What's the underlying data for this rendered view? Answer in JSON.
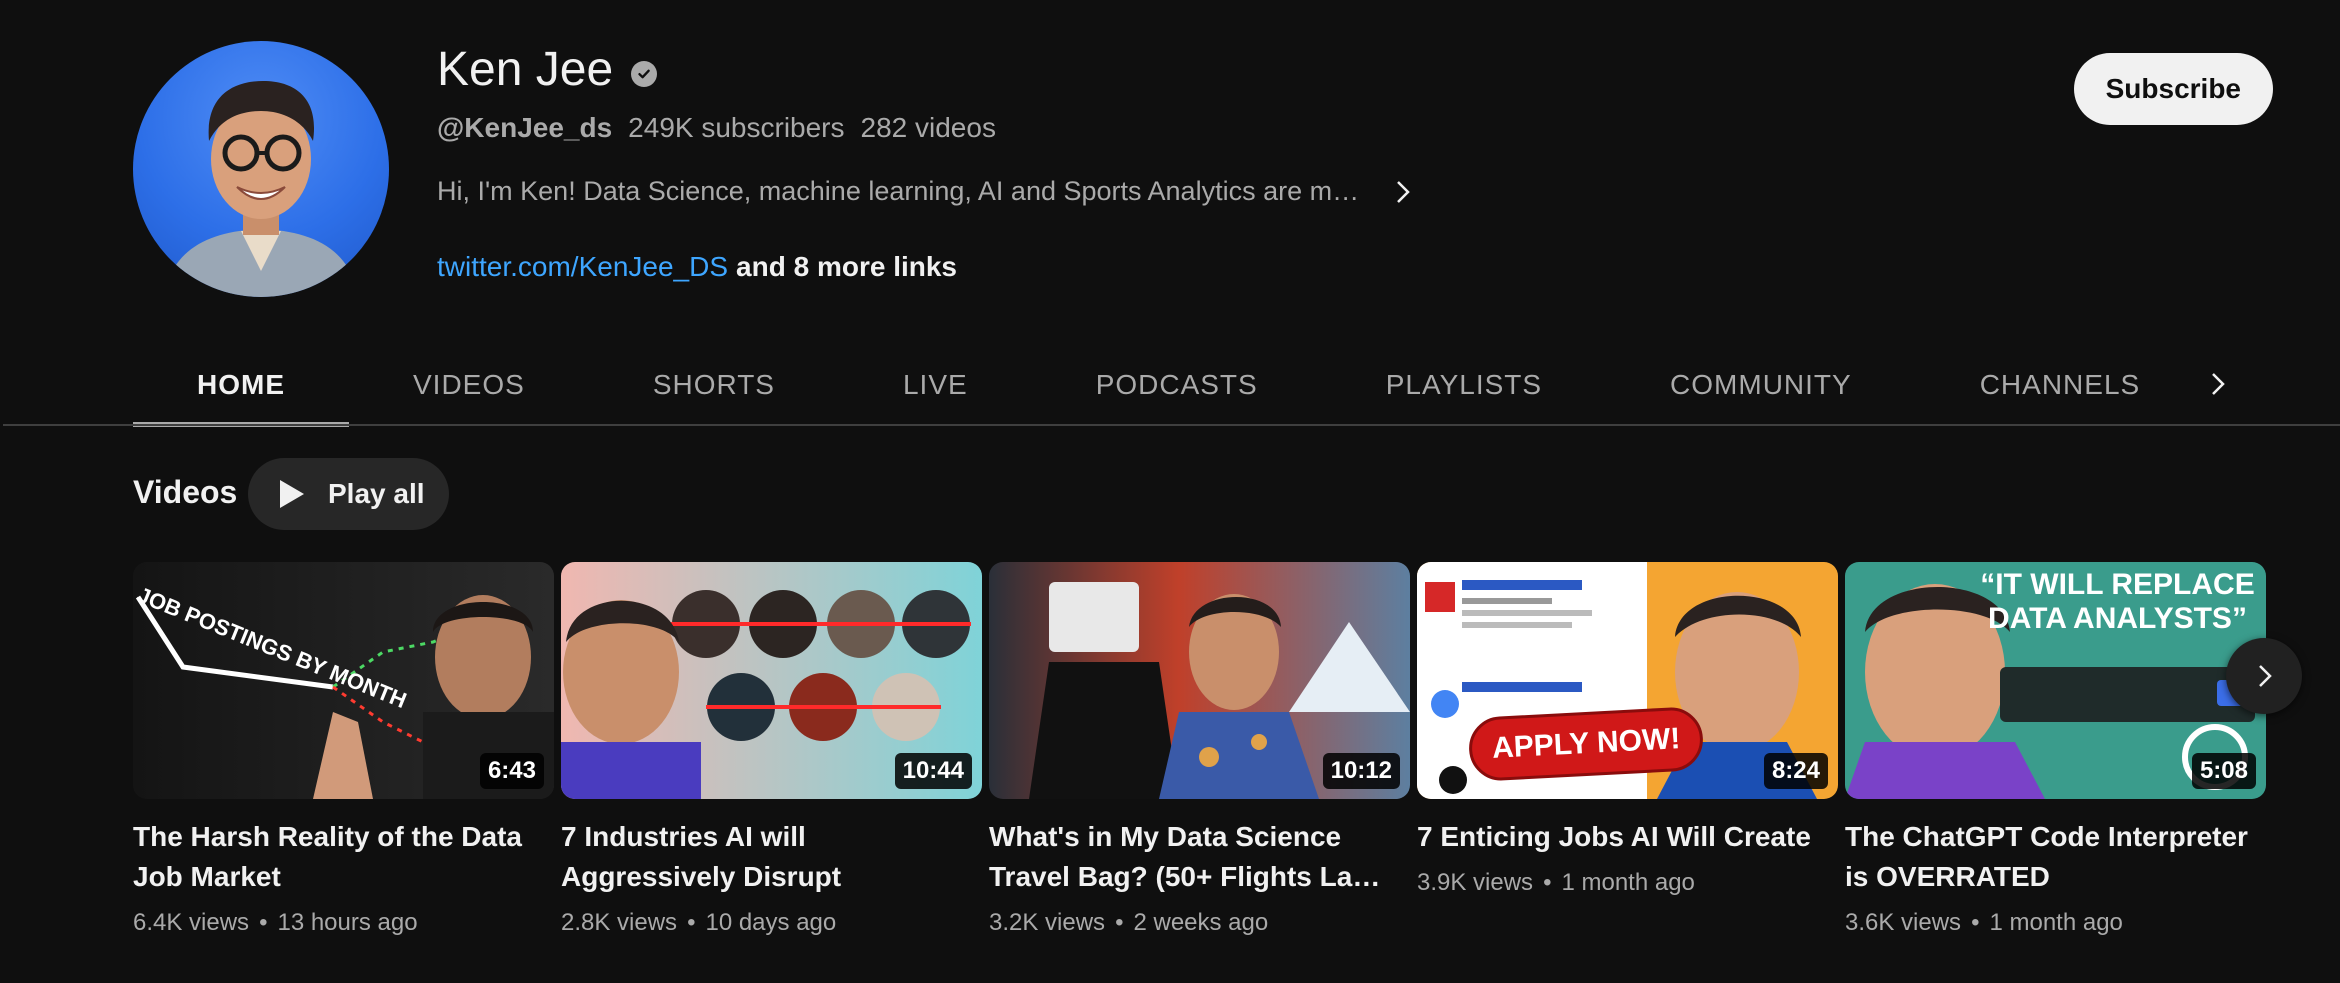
{
  "channel": {
    "name": "Ken Jee",
    "handle": "@KenJee_ds",
    "subscribers": "249K subscribers",
    "videos_count": "282 videos",
    "description": "Hi, I'm Ken! Data Science, machine learning, AI and Sports Analytics are m…",
    "link": "twitter.com/KenJee_DS",
    "more_links": "and 8 more links",
    "subscribe_label": "Subscribe"
  },
  "tabs": [
    {
      "label": "HOME",
      "active": true
    },
    {
      "label": "VIDEOS"
    },
    {
      "label": "SHORTS"
    },
    {
      "label": "LIVE"
    },
    {
      "label": "PODCASTS"
    },
    {
      "label": "PLAYLISTS"
    },
    {
      "label": "COMMUNITY"
    },
    {
      "label": "CHANNELS"
    }
  ],
  "section": {
    "title": "Videos",
    "play_all": "Play all"
  },
  "videos": [
    {
      "title": "The Harsh Reality of the Data Job Market",
      "views": "6.4K views",
      "age": "13 hours ago",
      "duration": "6:43",
      "thumb_text": "JOB POSTINGS BY MONTH"
    },
    {
      "title": "7 Industries AI will Aggressively Disrupt",
      "views": "2.8K views",
      "age": "10 days ago",
      "duration": "10:44",
      "thumb_text": ""
    },
    {
      "title": "What's in My Data Science Travel Bag? (50+ Flights La…",
      "views": "3.2K views",
      "age": "2 weeks ago",
      "duration": "10:12",
      "thumb_text": ""
    },
    {
      "title": "7 Enticing Jobs AI Will Create",
      "views": "3.9K views",
      "age": "1 month ago",
      "duration": "8:24",
      "thumb_text": "APPLY NOW!"
    },
    {
      "title": "The ChatGPT Code Interpreter is OVERRATED",
      "views": "3.6K views",
      "age": "1 month ago",
      "duration": "5:08",
      "thumb_text": "“IT WILL REPLACE DATA ANALYSTS”"
    }
  ],
  "colors": {
    "background": "#0f0f0f",
    "link": "#3ea6ff",
    "muted": "#aaaaaa"
  }
}
